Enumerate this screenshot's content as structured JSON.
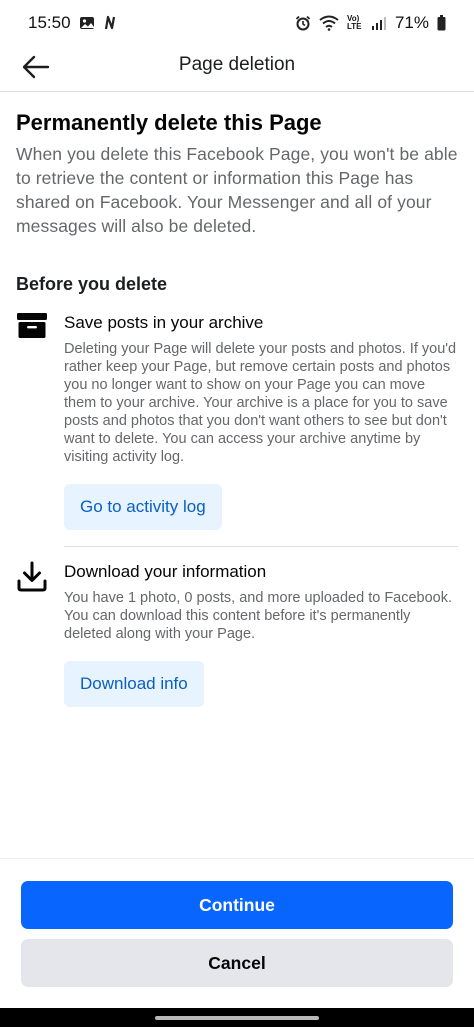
{
  "status_bar": {
    "time": "15:50",
    "network_label": "Vo) LTE",
    "battery": "71%"
  },
  "header": {
    "title": "Page deletion",
    "back_icon": "arrow-left-icon"
  },
  "main": {
    "heading": "Permanently delete this Page",
    "intro": "When you delete this Facebook Page, you won't be able to retrieve the content or information this Page has shared on Facebook. Your Messenger and all of your messages will also be deleted.",
    "subheading": "Before you delete",
    "sections": [
      {
        "icon": "archive-box-icon",
        "title": "Save posts in your archive",
        "description": "Deleting your Page will delete your posts and photos. If you'd rather keep your Page, but remove certain posts and photos you no longer want to show on your Page you can move them to your archive. Your archive is a place for you to save posts and photos that you don't want others to see but don't want to delete. You can access your archive anytime by visiting activity log.",
        "button_label": "Go to activity log"
      },
      {
        "icon": "download-icon",
        "title": "Download your information",
        "description": "You have 1 photo, 0 posts, and more uploaded to Facebook. You can download this content before it's permanently deleted along with your Page.",
        "button_label": "Download info"
      }
    ]
  },
  "footer": {
    "continue_label": "Continue",
    "cancel_label": "Cancel"
  },
  "colors": {
    "primary": "#0866ff",
    "secondary_button_bg": "#e4e6eb",
    "light_button_bg": "#e7f3ff",
    "light_button_text": "#0a5fc2",
    "secondary_text": "#65676b"
  }
}
